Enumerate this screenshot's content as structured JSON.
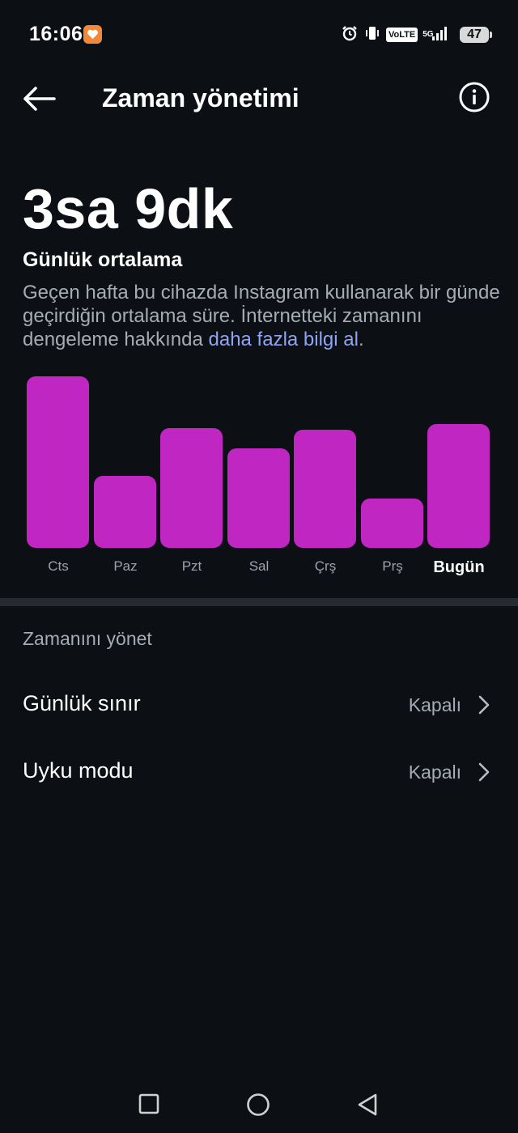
{
  "status_bar": {
    "time": "16:06",
    "app_icon": "heart-icon",
    "icons": [
      "alarm-icon",
      "vibrate-icon",
      "volte-badge",
      "5g-signal-icon",
      "battery-icon"
    ],
    "volte_label": "VoLTE",
    "network_label": "5G",
    "battery_level": "47"
  },
  "header": {
    "title": "Zaman yönetimi",
    "back_icon": "back-arrow-icon",
    "info_icon": "info-icon"
  },
  "summary": {
    "daily_average": "3sa 9dk",
    "label": "Günlük ortalama",
    "description": "Geçen hafta bu cihazda Instagram kullanarak bir günde geçirdiğin ortalama süre. İnternetteki zamanını dengeleme hakkında ",
    "link_text": "daha fazla bilgi al",
    "description_end": "."
  },
  "chart_data": {
    "type": "bar",
    "categories": [
      "Cts",
      "Paz",
      "Pzt",
      "Sal",
      "Çrş",
      "Prş",
      "Bugün"
    ],
    "values": [
      1.0,
      0.42,
      0.7,
      0.58,
      0.69,
      0.29,
      0.72
    ],
    "highlighted_category": "Bugün",
    "bar_color": "#c026c1",
    "title": "",
    "xlabel": "",
    "ylabel": ""
  },
  "manage": {
    "section_title": "Zamanını yönet",
    "rows": [
      {
        "label": "Günlük sınır",
        "value": "Kapalı",
        "icon": "chevron-right-icon"
      },
      {
        "label": "Uyku modu",
        "value": "Kapalı",
        "icon": "chevron-right-icon"
      }
    ]
  },
  "nav_bar": {
    "buttons": [
      "recents-square-icon",
      "home-circle-icon",
      "back-triangle-icon"
    ]
  },
  "colors": {
    "background": "#0c0f14",
    "accent_bar": "#c026c1",
    "link": "#8ea4f5",
    "secondary_text": "#a7abb4",
    "divider": "#262a31"
  }
}
